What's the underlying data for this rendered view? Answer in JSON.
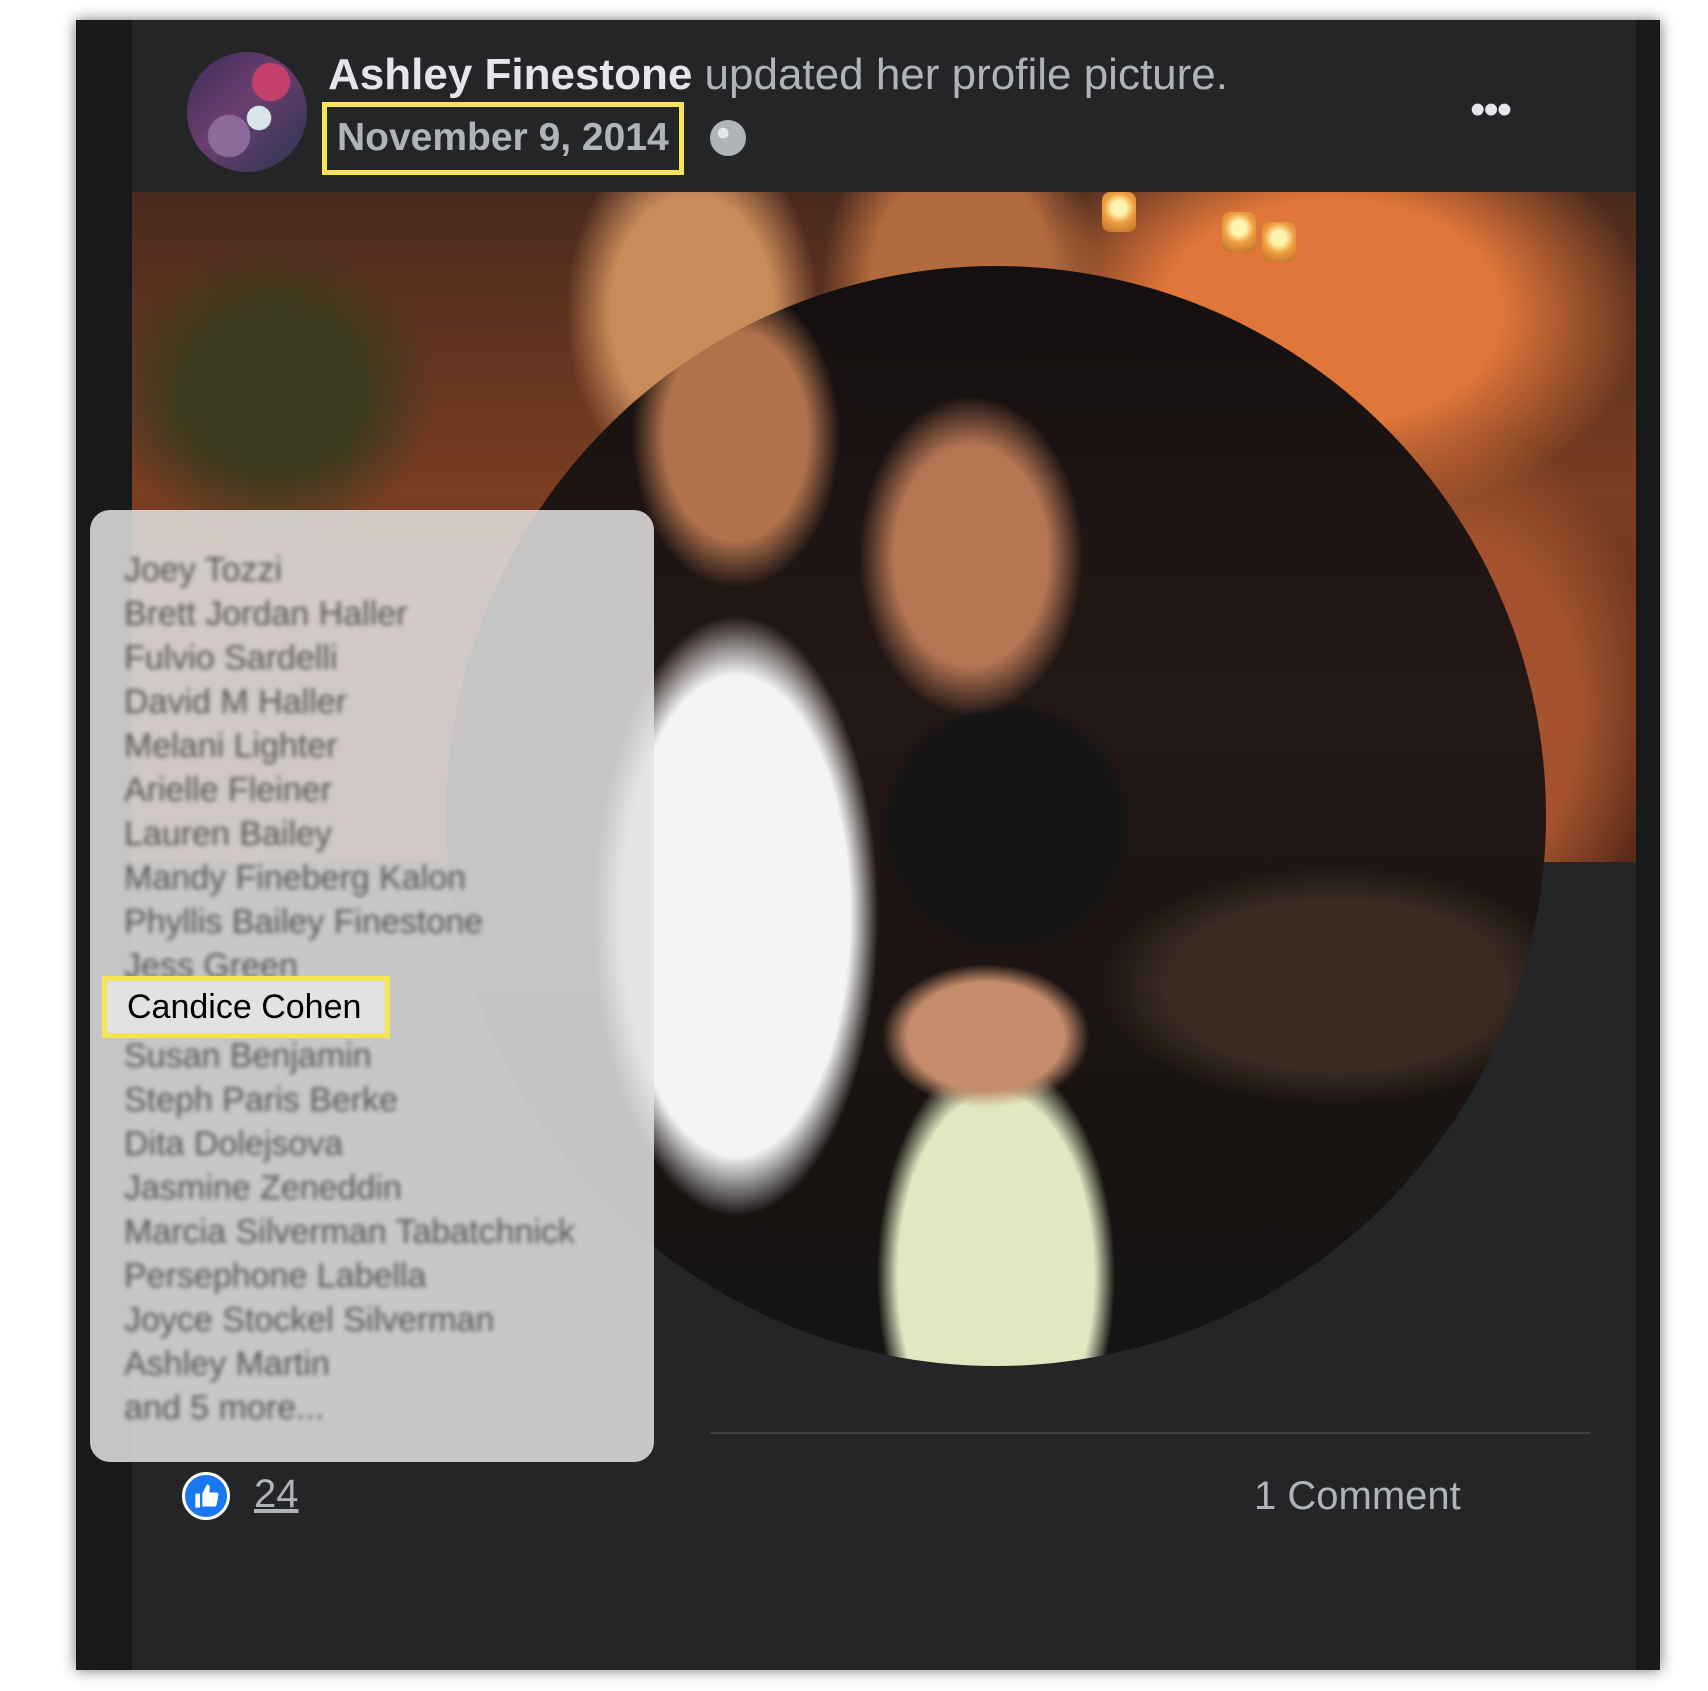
{
  "post": {
    "author_name": "Ashley Finestone",
    "action_text": "updated her profile picture.",
    "date": "November 9, 2014",
    "audience_icon": "globe-icon",
    "menu_icon": "more-options-icon",
    "menu_glyph": "•••"
  },
  "tags": {
    "visible_names": [
      "Joey Tozzi",
      "Brett Jordan Haller",
      "Fulvio Sardelli",
      "David M Haller",
      "Melani Lighter",
      "Arielle Fleiner",
      "Lauren Bailey",
      "Mandy Fineberg Kalon",
      "Phyllis Bailey Finestone",
      "Jess Green",
      "Candice Cohen",
      "Susan Benjamin",
      "Steph Paris Berke",
      "Dita Dolejsova",
      "Jasmine Zeneddin",
      "Marcia Silverman Tabatchnick",
      "Persephone Labella",
      "Joyce Stockel Silverman",
      "Ashley Martin",
      "and 5 more..."
    ],
    "highlighted_name": "Candice Cohen"
  },
  "footer": {
    "like_icon": "thumbs-up-icon",
    "like_count": "24",
    "comment_count": "1 Comment"
  },
  "colors": {
    "highlight_border": "#f5e556",
    "card_background": "#242526",
    "like_blue": "#1877f2"
  }
}
